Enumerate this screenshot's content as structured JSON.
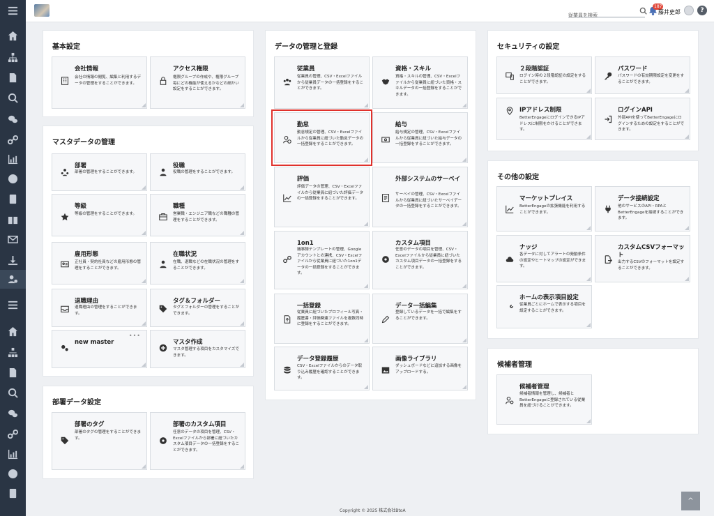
{
  "header": {
    "search_placeholder": "従業員を検索",
    "notification_count": "187",
    "user_name": "藤井史郎",
    "help_label": "?"
  },
  "sections": {
    "basic": {
      "title": "基本設定",
      "cards": [
        {
          "title": "会社情報",
          "desc": "会社の情報の閲覧、編集と利用するデータの管理をすることができます。",
          "icon": "building-icon"
        },
        {
          "title": "アクセス権限",
          "desc": "権限グループの作成や、権限グループ毎にどの機能が使えるかなどの細かい設定をすることができます。",
          "icon": "lock-icon"
        }
      ]
    },
    "master": {
      "title": "マスタデータの管理",
      "cards": [
        {
          "title": "部署",
          "desc": "部署の管理をすることができます。",
          "icon": "sitemap-icon"
        },
        {
          "title": "役職",
          "desc": "役職の管理をすることができます。",
          "icon": "user-tie-icon"
        },
        {
          "title": "等級",
          "desc": "等級の管理をすることができます。",
          "icon": "star-icon"
        },
        {
          "title": "職種",
          "desc": "営業職・エンジニア職などの職種の管理をすることができます。",
          "icon": "briefcase-icon"
        },
        {
          "title": "雇用形態",
          "desc": "正社員・契約社員などの雇用形態の管理をすることができます。",
          "icon": "id-card-icon"
        },
        {
          "title": "在職状況",
          "desc": "在職、退職などの在職状況の管理をすることができます。",
          "icon": "user-status-icon"
        },
        {
          "title": "退職理由",
          "desc": "退職理由の管理をすることができます。",
          "icon": "inbox-icon"
        },
        {
          "title": "タグ＆フォルダー",
          "desc": "タグとフォルダーの管理をすることができます。",
          "icon": "tag-icon"
        },
        {
          "title": "new master",
          "desc": "",
          "icon": "gears-icon",
          "menu": "•••"
        },
        {
          "title": "マスタ作成",
          "desc": "マスタ管理する項目をカスタマイズできます。",
          "icon": "plus-circle-icon"
        }
      ]
    },
    "dept": {
      "title": "部署データ設定",
      "cards": [
        {
          "title": "部署のタグ",
          "desc": "部署のタグの管理をすることができます。",
          "icon": "tag-icon"
        },
        {
          "title": "部署のカスタム項目",
          "desc": "任意のデータの項目を管理、CSV・Excelファイルから部署に紐づいたカスタム項目データの一括登録をすることができます。",
          "icon": "gear-icon"
        }
      ]
    },
    "data": {
      "title": "データの管理と登録",
      "cards": [
        {
          "title": "従業員",
          "desc": "従業員の管理、CSV・Excelファイルから従業員データの一括登録をすることができます。",
          "icon": "users-icon"
        },
        {
          "title": "資格・スキル",
          "desc": "資格・スキルの管理、CSV・Excelファイルから従業員に紐づいた資格・スキルデータの一括登録をすることができます。",
          "icon": "handshake-icon"
        },
        {
          "title": "勤怠",
          "desc": "勤怠規定の管理、CSV・Excelファイルから従業員に紐づいた勤怠データの一括登録をすることができます。",
          "icon": "user-clock-icon"
        },
        {
          "title": "給与",
          "desc": "給与規定の管理、CSV・Excelファイルから従業員に紐づいた給与データの一括登録をすることができます。",
          "icon": "money-icon"
        },
        {
          "title": "評価",
          "desc": "評価データの管理、CSV・Excelファイルから従業員に紐づいた評価データの一括登録をすることができます。",
          "icon": "chart-line-icon"
        },
        {
          "title": "外部システムのサーベイ",
          "desc": "サーベイの管理、CSV・Excelファイルから従業員に紐づいたサーベイデータの一括登録をすることができます。",
          "icon": "survey-icon"
        },
        {
          "title": "1on1",
          "desc": "議事録テンプレートの管理、Googleアカウントとの連携、CSV・Excelファイルから従業員に紐づいた1on1データの一括登録をすることができます。",
          "icon": "link-icon"
        },
        {
          "title": "カスタム項目",
          "desc": "任意のデータの項目を管理、CSV・Excelファイルから従業員に紐づいたカスタム項目データの一括登録をすることができます。",
          "icon": "gear-icon"
        },
        {
          "title": "一括登録",
          "desc": "従業員に紐づいたプロフィール写真・履歴書・評価関連ファイルを複数同時に登録をすることができます。",
          "icon": "file-upload-icon"
        },
        {
          "title": "データ一括編集",
          "desc": "登録しているデータを一括で編集をすることができます。",
          "icon": "pen-icon"
        },
        {
          "title": "データ登録履歴",
          "desc": "CSV・Excelファイルからのデータ取り込み履歴を確認することができます。",
          "icon": "database-icon"
        },
        {
          "title": "画像ライブラリ",
          "desc": "ダッシュボードなどに追加する画像をアップロードする。",
          "icon": "image-icon"
        }
      ]
    },
    "security": {
      "title": "セキュリティの設定",
      "cards": [
        {
          "title": "２段階認証",
          "desc": "ログイン時の２段階認証の設定をすることができます。",
          "icon": "mobile-icon"
        },
        {
          "title": "パスワード",
          "desc": "パスワードの有効期限設定を変更をすることができます。",
          "icon": "key-icon"
        },
        {
          "title": "IPアドレス制限",
          "desc": "BetterEngageにログインできるIPアドレスに制限をかけることができます。",
          "icon": "location-icon"
        },
        {
          "title": "ログインAPI",
          "desc": "外部APIを使ってBetterEngageにログインするための設定をすることができます。",
          "icon": "sign-in-icon"
        }
      ]
    },
    "other": {
      "title": "その他の設定",
      "cards": [
        {
          "title": "マーケットプレイス",
          "desc": "BetterEngageの拡張機能を利用することができます。",
          "icon": "chart-area-icon"
        },
        {
          "title": "データ接続設定",
          "desc": "他のサービスのAPI・RPAとBetterEngageを接続することができます。",
          "icon": "plug-icon"
        },
        {
          "title": "ナッジ",
          "desc": "各データに対してアラートの発動条件の設定やヒートマップの設定ができます。",
          "icon": "cloud-icon"
        },
        {
          "title": "カスタムCSVフォーマット",
          "desc": "出力するCSVのフォーマットを設定することができます。",
          "icon": "file-export-icon"
        },
        {
          "title": "ホームの表示項目設定",
          "desc": "従業員ごとにホームで表示する項目を設定することができます。",
          "icon": "tools-icon"
        }
      ]
    },
    "candidate": {
      "title": "候補者管理",
      "cards": [
        {
          "title": "候補者管理",
          "desc": "候補者情報を管理し、候補者とBetterEngageに登録されている従業員を紐づけることができます。",
          "icon": "user-cog-icon"
        }
      ]
    }
  },
  "footer": {
    "copyright": "Copyright © 2025 株式会社BtoA"
  },
  "back_to_top": "^"
}
